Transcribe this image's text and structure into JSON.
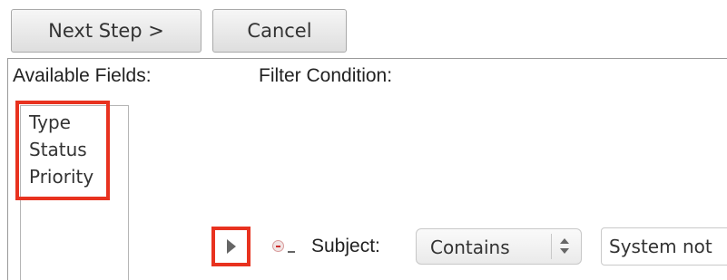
{
  "toolbar": {
    "next_step_label": "Next Step >",
    "cancel_label": "Cancel"
  },
  "labels": {
    "available_fields": "Available Fields:",
    "filter_condition": "Filter Condition:"
  },
  "available_fields": [
    "Type",
    "Status",
    "Priority"
  ],
  "filter_row": {
    "expand_icon": "triangle-right-icon",
    "remove_icon": "remove-circle-icon",
    "field_label": "Subject:",
    "operator": "Contains",
    "value": "System not"
  },
  "colors": {
    "highlight": "#e8321f"
  }
}
